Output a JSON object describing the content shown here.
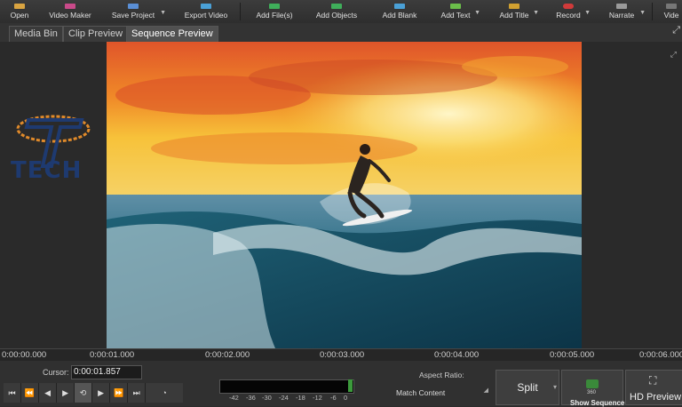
{
  "toolbar": {
    "buttons": [
      {
        "label": "Open",
        "color": "#d9a441"
      },
      {
        "label": "Video Maker",
        "color": "#c94a8a"
      },
      {
        "label": "Save Project",
        "color": "#5a8fd6"
      },
      {
        "label": "Export Video",
        "color": "#4aa0d6"
      },
      {
        "label": "Add File(s)",
        "color": "#3fae5a"
      },
      {
        "label": "Add Objects",
        "color": "#3fae5a"
      },
      {
        "label": "Add Blank",
        "color": "#4aa0d6"
      },
      {
        "label": "Add Text",
        "color": "#6bbf4a"
      },
      {
        "label": "Add Title",
        "color": "#d0a030"
      },
      {
        "label": "Record",
        "color": "#d03a3a"
      },
      {
        "label": "Narrate",
        "color": "#9a9a9a"
      },
      {
        "label": "Vide",
        "color": "#777777"
      }
    ]
  },
  "tabs": [
    {
      "label": "Media Bin"
    },
    {
      "label": "Clip Preview"
    },
    {
      "label": "Sequence Preview"
    }
  ],
  "logo": {
    "text": "TECH",
    "colors": {
      "primary": "#1e3a70",
      "accent": "#e08a2a"
    }
  },
  "ruler": {
    "ticks": [
      "0:00:00.000",
      "0:00:01.000",
      "0:00:02.000",
      "0:00:03.000",
      "0:00:04.000",
      "0:00:05.000",
      "0:00:06.000"
    ]
  },
  "controls": {
    "cursor_label": "Cursor:",
    "cursor_value": "0:00:01.857",
    "transport_icons": [
      "skip-start-icon",
      "prev-icon",
      "step-back-icon",
      "play-icon",
      "loop-icon",
      "step-forward-icon",
      "next-icon",
      "skip-end-icon",
      "fullscreen-icon"
    ],
    "meter_scale": [
      "-42",
      "-36",
      "-30",
      "-24",
      "-18",
      "-12",
      "-6",
      "0"
    ],
    "aspect_label": "Aspect Ratio:",
    "aspect_value": "Match Content",
    "split_label": "Split",
    "mid_small_label": "360",
    "hd_label": "HD Preview",
    "show_sequence_label": "Show Sequence"
  }
}
